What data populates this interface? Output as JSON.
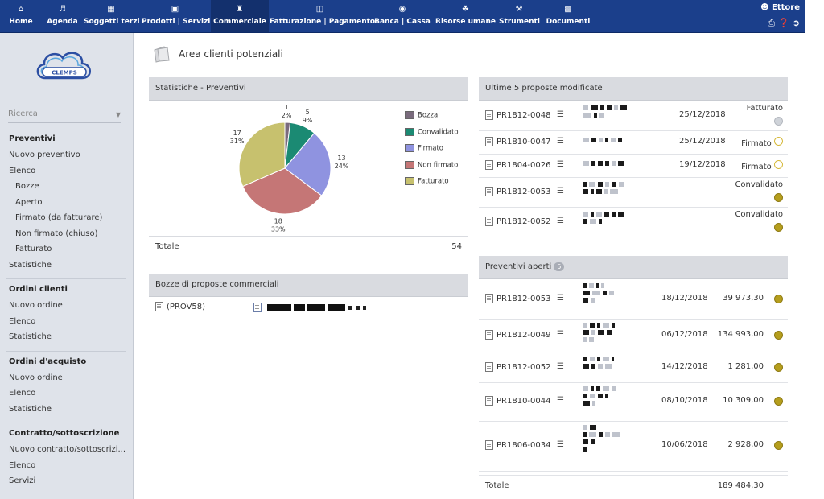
{
  "nav": {
    "items": [
      {
        "label": "Home",
        "icon": "home-icon"
      },
      {
        "label": "Agenda",
        "icon": "agenda-icon"
      },
      {
        "label": "Soggetti terzi",
        "icon": "third-parties-icon"
      },
      {
        "label": "Prodotti | Servizi",
        "icon": "products-icon"
      },
      {
        "label": "Commerciale",
        "icon": "commercial-icon"
      },
      {
        "label": "Fatturazione | Pagamento",
        "icon": "billing-icon"
      },
      {
        "label": "Banca | Cassa",
        "icon": "bank-icon"
      },
      {
        "label": "Risorse umane",
        "icon": "hr-icon"
      },
      {
        "label": "Strumenti",
        "icon": "tools-icon"
      },
      {
        "label": "Documenti",
        "icon": "documents-icon"
      }
    ],
    "active": "Commerciale",
    "user": "Ettore"
  },
  "sidebar": {
    "logo_text": "CLEMPS",
    "search_label": "Ricerca",
    "sections": [
      {
        "title": "Preventivi",
        "items": [
          {
            "label": "Nuovo preventivo",
            "sub": false
          },
          {
            "label": "Elenco",
            "sub": false
          },
          {
            "label": "Bozze",
            "sub": true
          },
          {
            "label": "Aperto",
            "sub": true
          },
          {
            "label": "Firmato (da fatturare)",
            "sub": true
          },
          {
            "label": "Non firmato (chiuso)",
            "sub": true
          },
          {
            "label": "Fatturato",
            "sub": true
          },
          {
            "label": "Statistiche",
            "sub": false
          }
        ]
      },
      {
        "title": "Ordini clienti",
        "items": [
          {
            "label": "Nuovo ordine",
            "sub": false
          },
          {
            "label": "Elenco",
            "sub": false
          },
          {
            "label": "Statistiche",
            "sub": false
          }
        ]
      },
      {
        "title": "Ordini d'acquisto",
        "items": [
          {
            "label": "Nuovo ordine",
            "sub": false
          },
          {
            "label": "Elenco",
            "sub": false
          },
          {
            "label": "Statistiche",
            "sub": false
          }
        ]
      },
      {
        "title": "Contratto/sottoscrizione",
        "items": [
          {
            "label": "Nuovo contratto/sottoscrizi...",
            "sub": false
          },
          {
            "label": "Elenco",
            "sub": false
          },
          {
            "label": "Servizi",
            "sub": false
          }
        ]
      }
    ]
  },
  "page": {
    "title": "Area clienti potenziali"
  },
  "stats_panel": {
    "title": "Statistiche - Preventivi",
    "total_label": "Totale",
    "total_value": "54"
  },
  "chart_data": {
    "type": "pie",
    "slices": [
      {
        "name": "Bozza",
        "value": 1,
        "pct": "2%",
        "color": "#7a6b7d"
      },
      {
        "name": "Convalidato",
        "value": 5,
        "pct": "9%",
        "color": "#1b8a73"
      },
      {
        "name": "Firmato",
        "value": 13,
        "pct": "24%",
        "color": "#8f93e0"
      },
      {
        "name": "Non firmato",
        "value": 18,
        "pct": "33%",
        "color": "#c57676"
      },
      {
        "name": "Fatturato",
        "value": 17,
        "pct": "31%",
        "color": "#c7c16e"
      }
    ]
  },
  "bozze_panel": {
    "title": "Bozze di proposte commerciali",
    "rows": [
      {
        "ref": "(PROV58)"
      }
    ]
  },
  "last5_panel": {
    "title": "Ultime 5 proposte modificate",
    "rows": [
      {
        "ref": "PR1812-0048",
        "date": "25/12/2018",
        "status": "Fatturato",
        "dot": "grey"
      },
      {
        "ref": "PR1810-0047",
        "date": "25/12/2018",
        "status": "Firmato",
        "dot": "ring"
      },
      {
        "ref": "PR1804-0026",
        "date": "19/12/2018",
        "status": "Firmato",
        "dot": "ring"
      },
      {
        "ref": "PR1812-0053",
        "date": "",
        "status": "Convalidato",
        "dot": "gold"
      },
      {
        "ref": "PR1812-0052",
        "date": "",
        "status": "Convalidato",
        "dot": "gold"
      }
    ]
  },
  "open_panel": {
    "title": "Preventivi aperti",
    "count": "5",
    "rows": [
      {
        "ref": "PR1812-0053",
        "date": "18/12/2018",
        "amount": "39 973,30"
      },
      {
        "ref": "PR1812-0049",
        "date": "06/12/2018",
        "amount": "134 993,00"
      },
      {
        "ref": "PR1812-0052",
        "date": "14/12/2018",
        "amount": "1 281,00"
      },
      {
        "ref": "PR1810-0044",
        "date": "08/10/2018",
        "amount": "10 309,00"
      },
      {
        "ref": "PR1806-0034",
        "date": "10/06/2018",
        "amount": "2 928,00"
      }
    ],
    "total_label": "Totale",
    "total_value": "189 484,30"
  },
  "colors": {
    "topbar": "#1b3f8b",
    "sidebar": "#dfe3ea",
    "panel_header": "#d9dbe0",
    "status_gold": "#b59e1d"
  }
}
